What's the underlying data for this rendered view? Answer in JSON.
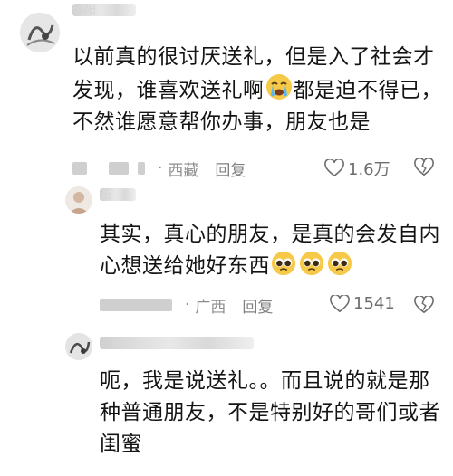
{
  "comments": [
    {
      "username": "启阳",
      "text_lines": [
        "以前真的很讨厌送礼，但是入了社会才",
        "发现，谁喜欢送礼啊",
        "都是迫不得已，",
        "不然谁愿意帮你办事，朋友也是"
      ],
      "location": "西藏",
      "reply_label": "回复",
      "likes": "1.6万",
      "emoji_icon": "crying-face-icon"
    },
    {
      "username": "花",
      "text_lines": [
        "其实，真心的朋友，是真的会发自内",
        "心想送给她好东西"
      ],
      "location": "广西",
      "reply_label": "回复",
      "likes": "1541",
      "emoji_icon": "pleading-face-icon"
    },
    {
      "username": "桐",
      "text_lines": [
        "呃，我是说送礼。。而且说的就是那",
        "种普通朋友，不是特别好的哥们或者",
        "闺蜜"
      ]
    }
  ],
  "colors": {
    "text": "#141414",
    "meta": "#8d8d8d",
    "emoji_yellow": "#f7c948"
  }
}
